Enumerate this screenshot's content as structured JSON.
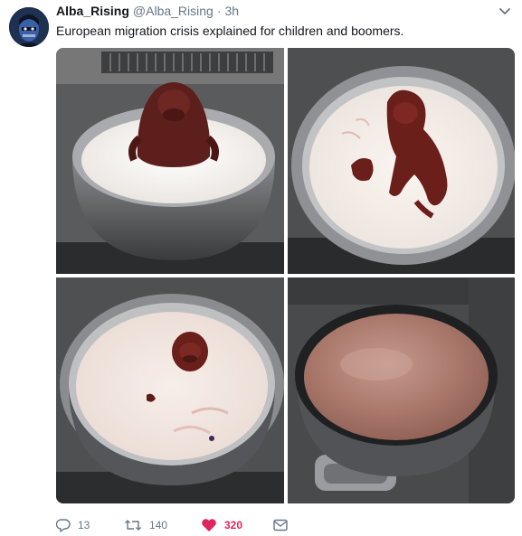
{
  "tweet": {
    "display_name": "Alba_Rising",
    "handle": "@Alba_Rising",
    "separator": "·",
    "time": "3h",
    "text": "European migration crisis explained for children and boomers."
  },
  "icons": {
    "avatar": "avatar-face",
    "menu": "chevron-down-icon",
    "reply": "reply-icon",
    "retweet": "retweet-icon",
    "like": "heart-icon",
    "message": "envelope-icon"
  },
  "actions": {
    "reply_count": "13",
    "retweet_count": "140",
    "like_count": "320"
  },
  "colors": {
    "text": "#14171a",
    "secondary": "#657786",
    "like": "#e0245e"
  }
}
